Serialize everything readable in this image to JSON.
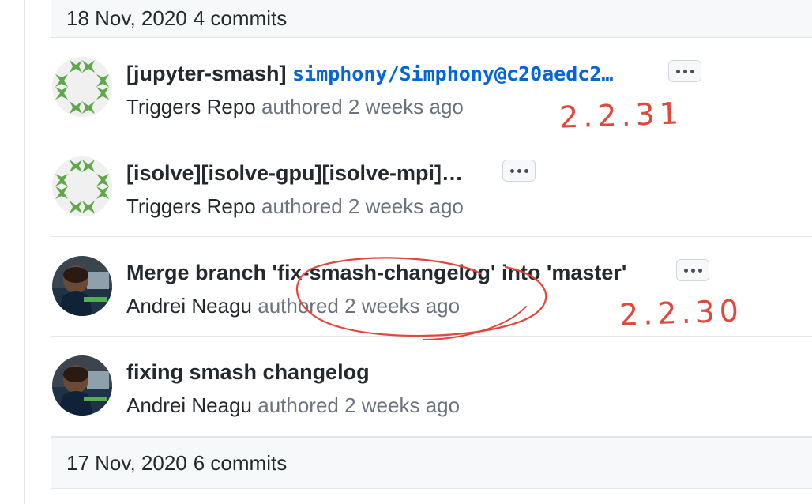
{
  "groups": [
    {
      "date": "18 Nov, 2020",
      "count": "4 commits"
    },
    {
      "date": "17 Nov, 2020",
      "count": "6 commits"
    }
  ],
  "commits": [
    {
      "title_prefix": "[jupyter-smash] ",
      "title_ref": "simphony/Simphony@c20aedc2…",
      "author": "Triggers Repo",
      "authored_text": "authored 2 weeks ago",
      "avatar": "identicon-green"
    },
    {
      "title_prefix": "[isolve][isolve-gpu][isolve-mpi]…",
      "title_ref": "",
      "author": "Triggers Repo",
      "authored_text": "authored 2 weeks ago",
      "avatar": "identicon-green"
    },
    {
      "title_prefix": "Merge branch 'fix-smash-changelog' into 'master'",
      "title_ref": "",
      "author": "Andrei Neagu",
      "authored_text": "authored 2 weeks ago",
      "avatar": "user-photo"
    },
    {
      "title_prefix": "fixing smash changelog",
      "title_ref": "",
      "author": "Andrei Neagu",
      "authored_text": "authored 2 weeks ago",
      "avatar": "user-photo"
    }
  ],
  "annotations": {
    "version_a": "2.2.31",
    "version_b": "2.2.30",
    "color": "#e0483e"
  },
  "icons": {
    "more": "kebab-horizontal-icon"
  },
  "colors": {
    "link": "#0366d6",
    "muted": "#6a737d",
    "text": "#24292e",
    "identicon": "#5fa84a"
  }
}
